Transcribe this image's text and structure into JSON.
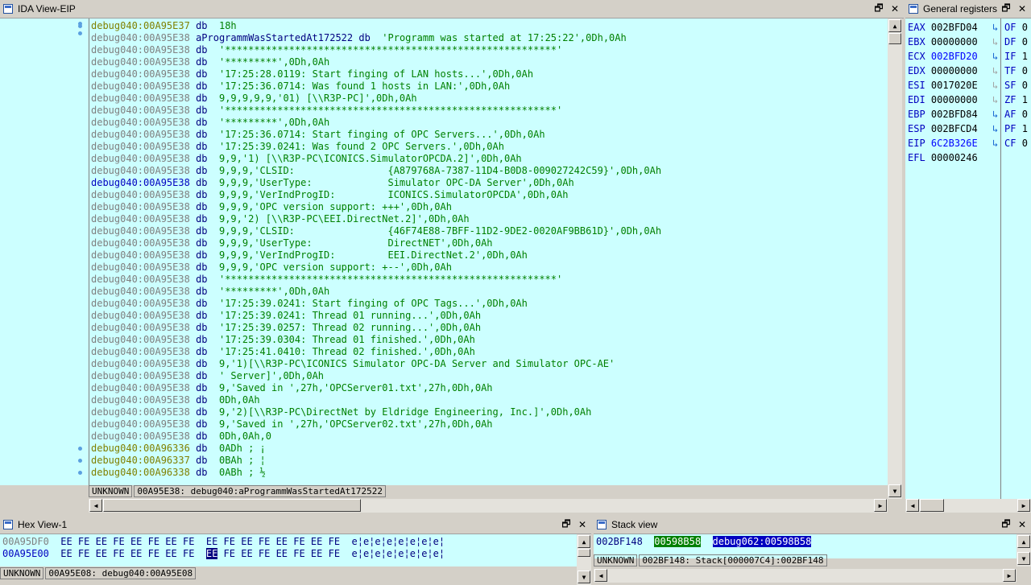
{
  "ida": {
    "title": "IDA View-EIP",
    "lines": [
      {
        "addr": "debug040:00A95E37",
        "style": "ol",
        "kw": "db",
        "ops": "18h"
      },
      {
        "addr": "debug040:00A95E38",
        "style": "plain",
        "name": "aProgrammWasStartedAt172522",
        "kw": "db",
        "ops": "'Programm was started at 17:25:22',0Dh,0Ah"
      },
      {
        "addr": "debug040:00A95E38",
        "style": "gray",
        "kw": "db",
        "ops": "'*********************************************************'"
      },
      {
        "addr": "debug040:00A95E38",
        "style": "gray",
        "kw": "db",
        "ops": "'*********',0Dh,0Ah"
      },
      {
        "addr": "debug040:00A95E38",
        "style": "gray",
        "kw": "db",
        "ops": "'17:25:28.0119: Start finging of LAN hosts...',0Dh,0Ah"
      },
      {
        "addr": "debug040:00A95E38",
        "style": "gray",
        "kw": "db",
        "ops": "'17:25:36.0714: Was found 1 hosts in LAN:',0Dh,0Ah"
      },
      {
        "addr": "debug040:00A95E38",
        "style": "gray",
        "kw": "db",
        "ops": "9,9,9,9,9,'01) [\\\\R3P-PC]',0Dh,0Ah"
      },
      {
        "addr": "debug040:00A95E38",
        "style": "gray",
        "kw": "db",
        "ops": "'*********************************************************'"
      },
      {
        "addr": "debug040:00A95E38",
        "style": "gray",
        "kw": "db",
        "ops": "'*********',0Dh,0Ah"
      },
      {
        "addr": "debug040:00A95E38",
        "style": "gray",
        "kw": "db",
        "ops": "'17:25:36.0714: Start finging of OPC Servers...',0Dh,0Ah"
      },
      {
        "addr": "debug040:00A95E38",
        "style": "gray",
        "kw": "db",
        "ops": "'17:25:39.0241: Was found 2 OPC Servers.',0Dh,0Ah"
      },
      {
        "addr": "debug040:00A95E38",
        "style": "gray",
        "kw": "db",
        "ops": "9,9,'1) [\\\\R3P-PC\\ICONICS.SimulatorOPCDA.2]',0Dh,0Ah"
      },
      {
        "addr": "debug040:00A95E38",
        "style": "gray",
        "kw": "db",
        "ops": "9,9,9,'CLSID:                {A879768A-7387-11D4-B0D8-009027242C59}',0Dh,0Ah"
      },
      {
        "addr": "debug040:00A95E38",
        "style": "hl",
        "kw": "db",
        "ops": "9,9,9,'UserType:             Simulator OPC-DA Server',0Dh,0Ah"
      },
      {
        "addr": "debug040:00A95E38",
        "style": "gray",
        "kw": "db",
        "ops": "9,9,9,'VerIndProgID:         ICONICS.SimulatorOPCDA',0Dh,0Ah"
      },
      {
        "addr": "debug040:00A95E38",
        "style": "gray",
        "kw": "db",
        "ops": "9,9,9,'OPC version support: +++',0Dh,0Ah"
      },
      {
        "addr": "debug040:00A95E38",
        "style": "gray",
        "kw": "db",
        "ops": "9,9,'2) [\\\\R3P-PC\\EEI.DirectNet.2]',0Dh,0Ah"
      },
      {
        "addr": "debug040:00A95E38",
        "style": "gray",
        "kw": "db",
        "ops": "9,9,9,'CLSID:                {46F74E88-7BFF-11D2-9DE2-0020AF9BB61D}',0Dh,0Ah"
      },
      {
        "addr": "debug040:00A95E38",
        "style": "gray",
        "kw": "db",
        "ops": "9,9,9,'UserType:             DirectNET',0Dh,0Ah"
      },
      {
        "addr": "debug040:00A95E38",
        "style": "gray",
        "kw": "db",
        "ops": "9,9,9,'VerIndProgID:         EEI.DirectNet.2',0Dh,0Ah"
      },
      {
        "addr": "debug040:00A95E38",
        "style": "gray",
        "kw": "db",
        "ops": "9,9,9,'OPC version support: +--',0Dh,0Ah"
      },
      {
        "addr": "debug040:00A95E38",
        "style": "gray",
        "kw": "db",
        "ops": "'*********************************************************'"
      },
      {
        "addr": "debug040:00A95E38",
        "style": "gray",
        "kw": "db",
        "ops": "'*********',0Dh,0Ah"
      },
      {
        "addr": "debug040:00A95E38",
        "style": "gray",
        "kw": "db",
        "ops": "'17:25:39.0241: Start finging of OPC Tags...',0Dh,0Ah"
      },
      {
        "addr": "debug040:00A95E38",
        "style": "gray",
        "kw": "db",
        "ops": "'17:25:39.0241: Thread 01 running...',0Dh,0Ah"
      },
      {
        "addr": "debug040:00A95E38",
        "style": "gray",
        "kw": "db",
        "ops": "'17:25:39.0257: Thread 02 running...',0Dh,0Ah"
      },
      {
        "addr": "debug040:00A95E38",
        "style": "gray",
        "kw": "db",
        "ops": "'17:25:39.0304: Thread 01 finished.',0Dh,0Ah"
      },
      {
        "addr": "debug040:00A95E38",
        "style": "gray",
        "kw": "db",
        "ops": "'17:25:41.0410: Thread 02 finished.',0Dh,0Ah"
      },
      {
        "addr": "debug040:00A95E38",
        "style": "gray",
        "kw": "db",
        "ops": "9,'1)[\\\\R3P-PC\\ICONICS Simulator OPC-DA Server and Simulator OPC-AE'"
      },
      {
        "addr": "debug040:00A95E38",
        "style": "gray",
        "kw": "db",
        "ops": "' Server]',0Dh,0Ah"
      },
      {
        "addr": "debug040:00A95E38",
        "style": "gray",
        "kw": "db",
        "ops": "9,'Saved in ',27h,'OPCServer01.txt',27h,0Dh,0Ah"
      },
      {
        "addr": "debug040:00A95E38",
        "style": "gray",
        "kw": "db",
        "ops": "0Dh,0Ah"
      },
      {
        "addr": "debug040:00A95E38",
        "style": "gray",
        "kw": "db",
        "ops": "9,'2)[\\\\R3P-PC\\DirectNet by Eldridge Engineering, Inc.]',0Dh,0Ah"
      },
      {
        "addr": "debug040:00A95E38",
        "style": "gray",
        "kw": "db",
        "ops": "9,'Saved in ',27h,'OPCServer02.txt',27h,0Dh,0Ah"
      },
      {
        "addr": "debug040:00A95E38",
        "style": "gray",
        "kw": "db",
        "ops": "0Dh,0Ah,0"
      },
      {
        "addr": "debug040:00A96336",
        "style": "ol",
        "kw": "db",
        "ops": "0ADh ; ¡"
      },
      {
        "addr": "debug040:00A96337",
        "style": "ol",
        "kw": "db",
        "ops": "0BAh ; ¦"
      },
      {
        "addr": "debug040:00A96338",
        "style": "ol",
        "kw": "db",
        "ops": "0ABh ; ½"
      }
    ],
    "status_left": "UNKNOWN",
    "status_right": "00A95E38: debug040:aProgrammWasStartedAt172522"
  },
  "registers": {
    "title": "General registers",
    "items": [
      {
        "name": "EAX",
        "value": "002BFD04",
        "changed": false,
        "arrow": "↳"
      },
      {
        "name": "EBX",
        "value": "00000000",
        "changed": false,
        "arrow": "↳"
      },
      {
        "name": "ECX",
        "value": "002BFD20",
        "changed": true,
        "arrow": "↳"
      },
      {
        "name": "EDX",
        "value": "00000000",
        "changed": false,
        "arrow": "↳"
      },
      {
        "name": "ESI",
        "value": "0017020E",
        "changed": false,
        "arrow": "↳"
      },
      {
        "name": "EDI",
        "value": "00000000",
        "changed": false,
        "arrow": "↳"
      },
      {
        "name": "EBP",
        "value": "002BFD84",
        "changed": false,
        "arrow": "↳"
      },
      {
        "name": "ESP",
        "value": "002BFCD4",
        "changed": false,
        "arrow": "↳"
      },
      {
        "name": "EIP",
        "value": "6C2B326E",
        "changed": true,
        "arrow": "↳"
      },
      {
        "name": "EFL",
        "value": "00000246",
        "changed": false,
        "arrow": ""
      }
    ],
    "flags": [
      {
        "name": "OF",
        "value": "0"
      },
      {
        "name": "DF",
        "value": "0"
      },
      {
        "name": "IF",
        "value": "1"
      },
      {
        "name": "TF",
        "value": "0"
      },
      {
        "name": "SF",
        "value": "0"
      },
      {
        "name": "ZF",
        "value": "1"
      },
      {
        "name": "AF",
        "value": "0"
      },
      {
        "name": "PF",
        "value": "1"
      },
      {
        "name": "CF",
        "value": "0"
      }
    ]
  },
  "hex": {
    "title": "Hex View-1",
    "rows": [
      {
        "addr": "00A95DF0",
        "bytes1": "EE FE EE FE EE FE EE FE",
        "bytes2": "EE FE EE FE EE FE EE FE",
        "ascii": "e¦e¦e¦e¦e¦e¦e¦e¦"
      },
      {
        "addr": "00A95E00",
        "bytes1": "EE FE EE FE EE FE EE FE",
        "bytes2_sel": "EE",
        "bytes2": " FE EE FE EE FE EE FE",
        "ascii": "e¦e¦e¦e¦e¦e¦e¦e¦"
      }
    ],
    "status_left": "UNKNOWN",
    "status_right": "00A95E08: debug040:00A95E08"
  },
  "stack": {
    "title": "Stack view",
    "row": {
      "addr": "002BF148",
      "value": "00598B58",
      "ref": "debug062:00598B58"
    },
    "status_left": "UNKNOWN",
    "status_right": "002BF148: Stack[000007C4]:002BF148"
  },
  "window_buttons": {
    "restore": "🗗",
    "close": "✕"
  },
  "scroll_glyphs": {
    "up": "▲",
    "down": "▼",
    "left": "◀",
    "right": "▶"
  }
}
